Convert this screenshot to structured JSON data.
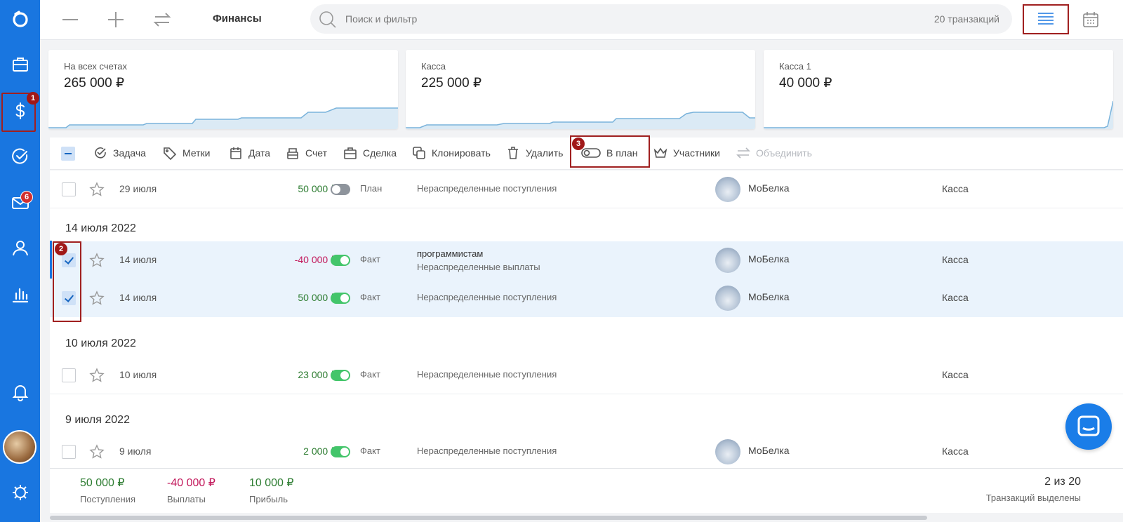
{
  "sidebar": {
    "badges": {
      "finance": "1",
      "mail": "6"
    }
  },
  "topbar": {
    "title": "Финансы",
    "search_placeholder": "Поиск и фильтр",
    "transactions_count": "20 транзакций"
  },
  "cards": [
    {
      "label": "На всех счетах",
      "value": "265 000 ₽"
    },
    {
      "label": "Касса",
      "value": "225 000 ₽"
    },
    {
      "label": "Касса 1",
      "value": "40 000 ₽"
    }
  ],
  "toolbar": {
    "task": "Задача",
    "tags": "Метки",
    "date": "Дата",
    "account": "Счет",
    "deal": "Сделка",
    "clone": "Клонировать",
    "delete": "Удалить",
    "to_plan": "В план",
    "participants": "Участники",
    "merge": "Объединить"
  },
  "annotations": {
    "n1": "1",
    "n2": "2",
    "n3": "3"
  },
  "groups": [
    "14 июля 2022",
    "10 июля 2022",
    "9 июля 2022"
  ],
  "rows": [
    {
      "date": "29 июля",
      "amount": "50 000 ₽",
      "status": "План",
      "desc": "Нераспределенные поступления",
      "person": "МоБелка",
      "account": "Касса"
    },
    {
      "date": "14 июля",
      "amount": "-40 000 ₽",
      "status": "Факт",
      "desc_title": "программистам",
      "desc": "Нераспределенные выплаты",
      "person": "МоБелка",
      "account": "Касса"
    },
    {
      "date": "14 июля",
      "amount": "50 000 ₽",
      "status": "Факт",
      "desc": "Нераспределенные поступления",
      "person": "МоБелка",
      "account": "Касса"
    },
    {
      "date": "10 июля",
      "amount": "23 000 ₽",
      "status": "Факт",
      "desc": "Нераспределенные поступления",
      "person": "",
      "account": "Касса"
    },
    {
      "date": "9 июля",
      "amount": "2 000 ₽",
      "status": "Факт",
      "desc": "Нераспределенные поступления",
      "person": "МоБелка",
      "account": "Касса"
    }
  ],
  "summary": {
    "income_value": "50 000 ₽",
    "income_label": "Поступления",
    "expense_value": "-40 000 ₽",
    "expense_label": "Выплаты",
    "profit_value": "10 000 ₽",
    "profit_label": "Прибыль",
    "selected_value": "2 из 20",
    "selected_label": "Транзакций выделены"
  },
  "colors": {
    "accent": "#1976e0",
    "positive": "#2e7d32",
    "negative": "#c2185b",
    "toggle_on": "#43c56a",
    "highlight_frame": "#a02020"
  }
}
